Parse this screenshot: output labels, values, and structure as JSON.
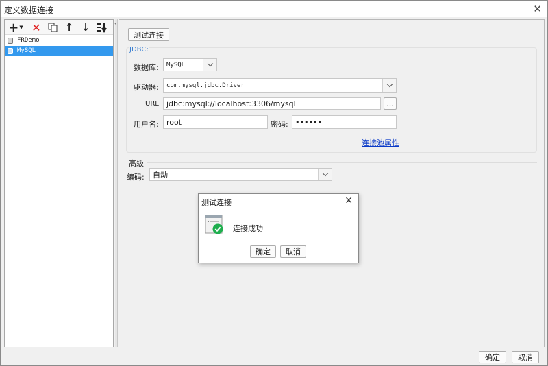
{
  "window": {
    "title": "定义数据连接"
  },
  "toolbar": {
    "add_icon": "plus-icon",
    "delete_icon": "x-icon",
    "copy_icon": "copy-icon",
    "up_icon": "arrow-up-icon",
    "down_icon": "arrow-down-icon",
    "sort_icon": "sort-icon"
  },
  "tree": {
    "items": [
      {
        "label": "FRDemo",
        "selected": false
      },
      {
        "label": "MySQL",
        "selected": true
      }
    ]
  },
  "main": {
    "test_button": "测试连接",
    "jdbc_legend": "JDBC:",
    "database_label": "数据库:",
    "database_value": "MySQL",
    "driver_label": "驱动器:",
    "driver_value": "com.mysql.jdbc.Driver",
    "url_label": "URL",
    "url_value": "jdbc:mysql://localhost:3306/mysql",
    "url_more": "...",
    "username_label": "用户名:",
    "username_value": "root",
    "password_label": "密码:",
    "password_value": "••••••",
    "pool_link": "连接池属性",
    "advanced_title": "高级",
    "encoding_label": "编码:",
    "encoding_value": "自动"
  },
  "dialog": {
    "title": "测试连接",
    "message": "连接成功",
    "ok": "确定",
    "cancel": "取消"
  },
  "footer": {
    "ok": "确定",
    "cancel": "取消"
  },
  "colors": {
    "selection": "#3399ee",
    "link": "#0a3ac8",
    "success": "#1fae4e",
    "delete": "#e02020"
  }
}
